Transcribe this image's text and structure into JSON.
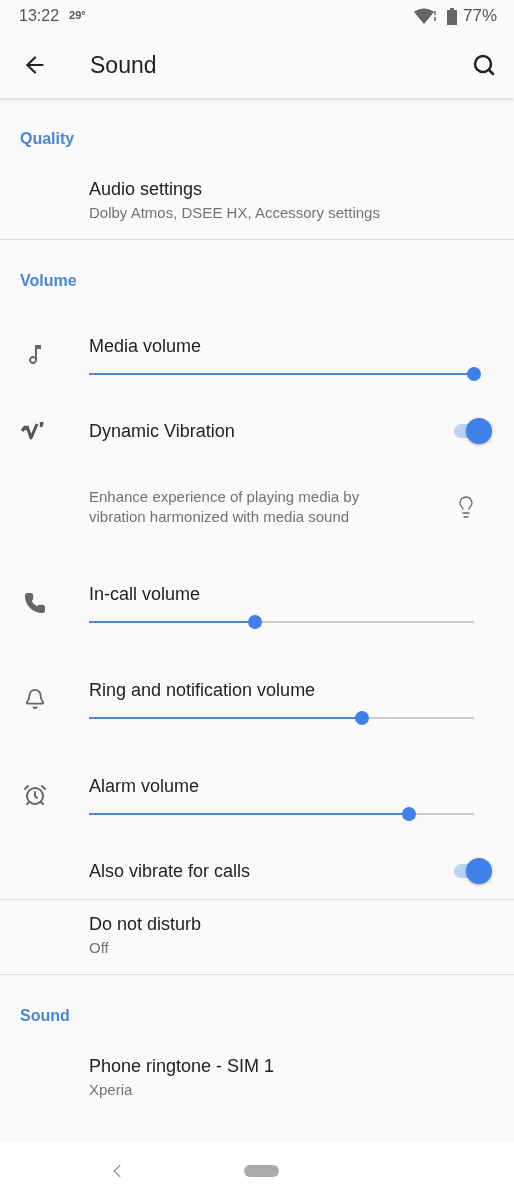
{
  "status_bar": {
    "time": "13:22",
    "temperature": "29°",
    "battery": "77%"
  },
  "toolbar": {
    "title": "Sound"
  },
  "sections": [
    {
      "header": "Quality",
      "items": [
        {
          "kind": "link",
          "title": "Audio settings",
          "summary": "Dolby Atmos, DSEE HX, Accessory settings"
        }
      ]
    },
    {
      "header": "Volume",
      "items": [
        {
          "kind": "slider",
          "title": "Media volume",
          "level": 1.0
        },
        {
          "kind": "switch",
          "title": "Dynamic Vibration",
          "on": true
        },
        {
          "kind": "note",
          "text": "Enhance experience of playing media by vibration harmonized with media sound"
        },
        {
          "kind": "slider",
          "title": "In-call volume",
          "level": 0.43
        },
        {
          "kind": "slider",
          "title": "Ring and notification volume",
          "level": 0.71
        },
        {
          "kind": "slider",
          "title": "Alarm volume",
          "level": 0.83
        },
        {
          "kind": "switch",
          "title": "Also vibrate for calls",
          "on": true
        }
      ]
    },
    {
      "items": [
        {
          "kind": "link",
          "title": "Do not disturb",
          "summary": "Off"
        }
      ]
    },
    {
      "header": "Sound",
      "items": [
        {
          "kind": "link",
          "title": "Phone ringtone - SIM 1",
          "summary": "Xperia"
        }
      ]
    }
  ]
}
